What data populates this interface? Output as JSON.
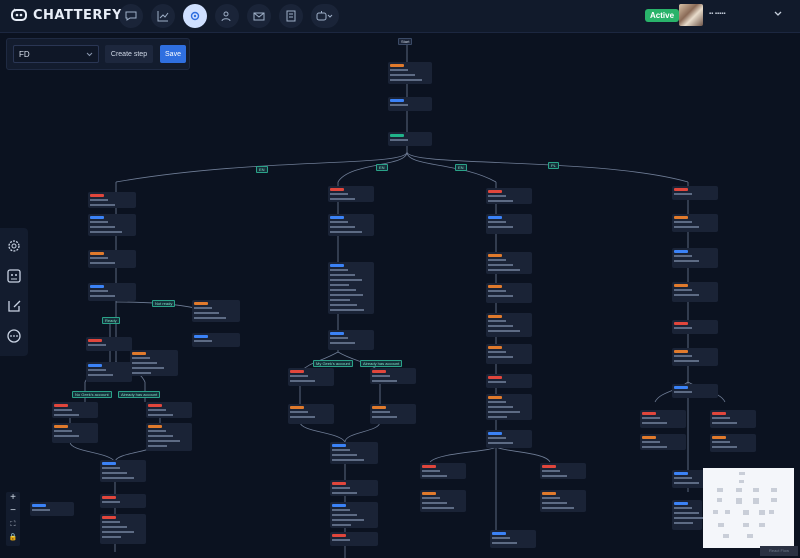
{
  "app": {
    "name": "CHATTERFY"
  },
  "nav": [
    {
      "icon": "chat-bubble-icon",
      "active": false
    },
    {
      "icon": "analytics-chart-icon",
      "active": false
    },
    {
      "icon": "settings-gear-icon",
      "active": true
    },
    {
      "icon": "users-icon",
      "active": false
    },
    {
      "icon": "mail-icon",
      "active": false
    },
    {
      "icon": "document-icon",
      "active": false
    },
    {
      "icon": "bot-dropdown-icon",
      "active": false
    }
  ],
  "header": {
    "status": "Active",
    "username": "▪▪ ▪▪▪▪▪",
    "status_color": "#29b36a"
  },
  "toolbar": {
    "flow_select": "FD",
    "create_label": "Create step",
    "save_label": "Save"
  },
  "canvas": {
    "start_label": "Start",
    "branches": [
      "EN",
      "EN",
      "EN",
      "PL"
    ],
    "side_labels": [
      "Not ready",
      "Ready",
      "My Geek's account",
      "Already has account",
      "No Geek's account",
      "Already has account"
    ],
    "minimap_label": "React Flow"
  },
  "colors": {
    "accent": "#2f6fe0",
    "tag_red": "#e0463c",
    "tag_orange": "#e07a2c",
    "tag_blue": "#3b82f6",
    "tag_teal": "#20b38a"
  }
}
